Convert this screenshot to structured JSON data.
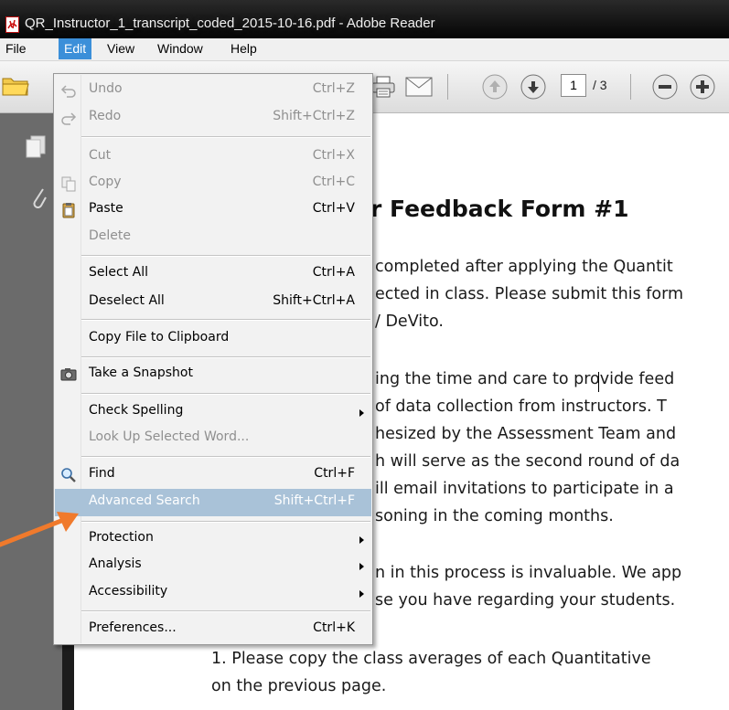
{
  "window": {
    "title": "QR_Instructor_1_transcript_coded_2015-10-16.pdf - Adobe Reader"
  },
  "menubar": {
    "items": [
      {
        "label": "File"
      },
      {
        "label": "Edit"
      },
      {
        "label": "View"
      },
      {
        "label": "Window"
      },
      {
        "label": "Help"
      }
    ]
  },
  "toolbar": {
    "page_number": "1",
    "page_total": "/ 3"
  },
  "edit_menu": {
    "items": [
      {
        "label": "Undo",
        "shortcut": "Ctrl+Z",
        "state": "disabled",
        "icon": "undo-icon"
      },
      {
        "label": "Redo",
        "shortcut": "Shift+Ctrl+Z",
        "state": "disabled",
        "icon": "redo-icon"
      },
      {
        "label": "Cut",
        "shortcut": "Ctrl+X",
        "state": "disabled"
      },
      {
        "label": "Copy",
        "shortcut": "Ctrl+C",
        "state": "disabled",
        "icon": "copy-icon"
      },
      {
        "label": "Paste",
        "shortcut": "Ctrl+V",
        "state": "enabled",
        "icon": "paste-icon"
      },
      {
        "label": "Delete",
        "shortcut": "",
        "state": "disabled"
      },
      {
        "label": "Select All",
        "shortcut": "Ctrl+A",
        "state": "enabled"
      },
      {
        "label": "Deselect All",
        "shortcut": "Shift+Ctrl+A",
        "state": "enabled"
      },
      {
        "label": "Copy File to Clipboard",
        "shortcut": "",
        "state": "enabled"
      },
      {
        "label": "Take a Snapshot",
        "shortcut": "",
        "state": "enabled",
        "icon": "camera-icon"
      },
      {
        "label": "Check Spelling",
        "shortcut": "",
        "state": "enabled",
        "submenu": true
      },
      {
        "label": "Look Up Selected Word...",
        "shortcut": "",
        "state": "disabled"
      },
      {
        "label": "Find",
        "shortcut": "Ctrl+F",
        "state": "enabled",
        "icon": "magnifier-icon"
      },
      {
        "label": "Advanced Search",
        "shortcut": "Shift+Ctrl+F",
        "state": "highlighted"
      },
      {
        "label": "Protection",
        "shortcut": "",
        "state": "enabled",
        "submenu": true
      },
      {
        "label": "Analysis",
        "shortcut": "",
        "state": "enabled",
        "submenu": true
      },
      {
        "label": "Accessibility",
        "shortcut": "",
        "state": "enabled",
        "submenu": true
      },
      {
        "label": "Preferences...",
        "shortcut": "Ctrl+K",
        "state": "enabled"
      }
    ]
  },
  "document": {
    "heading": "r Feedback Form #1",
    "lines": [
      "completed after applying the Quantit",
      "ected in class.  Please submit this form",
      "/ DeVito.",
      "ing the time and care to provide feed",
      "of data collection from instructors.  T",
      "hesized by the Assessment Team and",
      "h will serve as the second round of da",
      "ill email invitations to participate in a",
      "soning in the coming months.",
      "n in this process is invaluable.  We app",
      "se you have regarding your students.",
      "1.  Please copy the class averages of each Quantitative",
      "on the previous page."
    ]
  },
  "colors": {
    "menu_highlight": "#a9c2d8",
    "active_menu": "#3b8fd9",
    "annotation_arrow": "#f07a2c"
  }
}
